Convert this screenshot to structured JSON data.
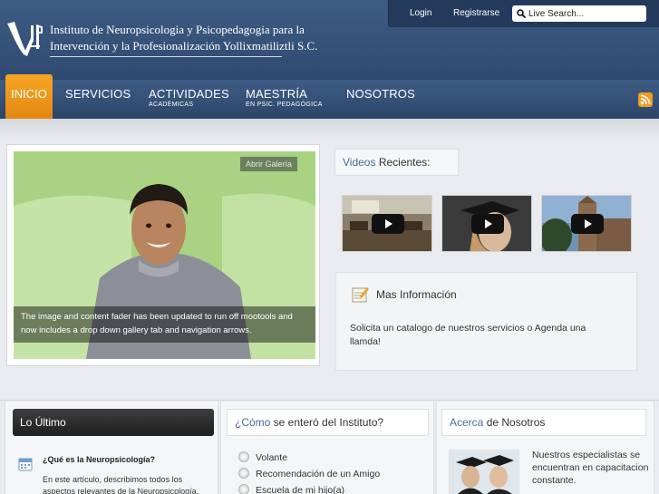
{
  "header": {
    "logo_line1": "Instituto de Neuropsicologia y Psicopedagogia para la",
    "logo_line2": "Intervención y la Profesionalización Yollixmatiliztli S.C.",
    "login": "Login",
    "register": "Registrarse",
    "search_placeholder": "Live Search..."
  },
  "nav": {
    "items": [
      {
        "label": "INICIO",
        "sub": ""
      },
      {
        "label": "SERVICIOS",
        "sub": ""
      },
      {
        "label": "ACTIVIDADES",
        "sub": "ACADÉMICAS"
      },
      {
        "label": "MAESTRÍA",
        "sub": "EN PSIC. PEDAGÓGICA"
      },
      {
        "label": "NOSOTROS",
        "sub": ""
      }
    ],
    "rss_icon": "rss-icon"
  },
  "slideshow": {
    "gallery_button": "Abrir Galería",
    "caption": "The image and content fader has been updated to run off mootools and now includes a drop down gallery tab and navigation arrows."
  },
  "videos": {
    "title_accent": "Videos",
    "title_rest": " Recientes:"
  },
  "info": {
    "title": "Mas Información",
    "body": "Solicita un catalogo de nuestros servicios o Agenda una llamda!"
  },
  "latest": {
    "title_part1": "Lo",
    "title_part2": " Último",
    "article_title": "¿Qué es la Neuropsicología?",
    "article_body": "En este artículo, describimos todos los aspectos relevantes de la Neuropsicología."
  },
  "survey": {
    "title_accent": "¿Cómo",
    "title_rest": " se enteró del Instituto?",
    "options": [
      "Volante",
      "Recomendación de un Amigo",
      "Escuela de mi hijo(a)"
    ]
  },
  "about": {
    "title_accent": "Acerca",
    "title_rest": " de Nosotros",
    "text": "Nuestros especialistas se encuentran en capacitacion constante."
  },
  "colors": {
    "header_blue": "#3d5c84",
    "active_orange": "#f6a623",
    "accent_blue": "#4a6a9a"
  }
}
